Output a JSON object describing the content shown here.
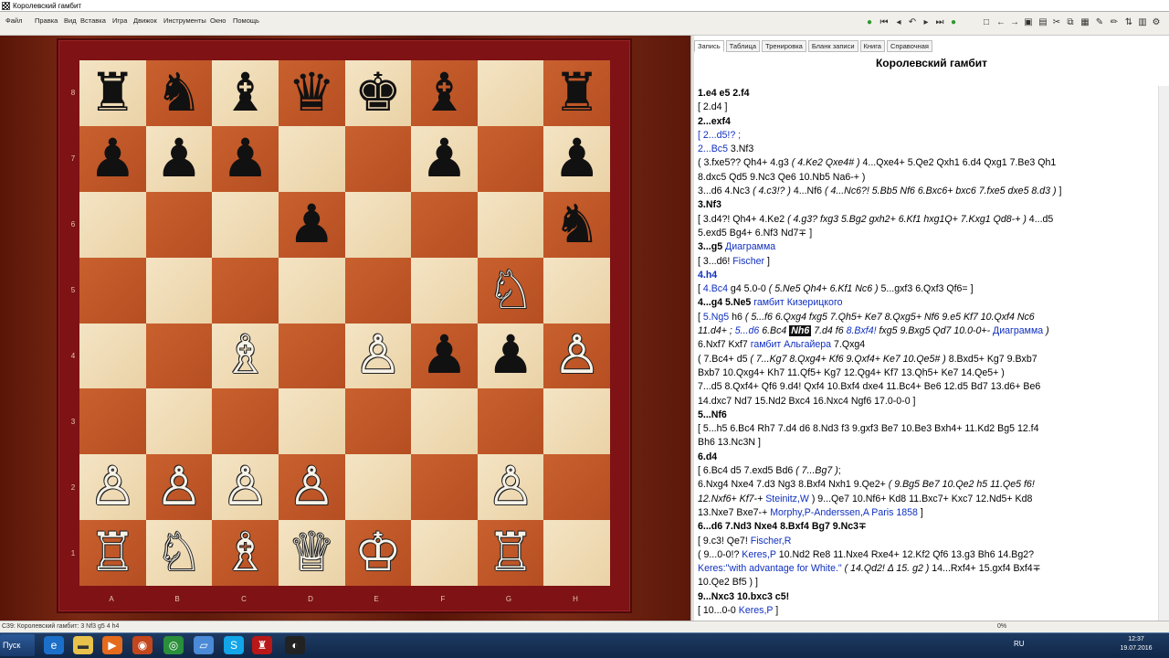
{
  "window": {
    "title": "Королевский гамбит"
  },
  "menu": [
    "Файл",
    "Правка",
    "Вид",
    "Вставка",
    "Игра",
    "Движок",
    "Инструменты",
    "Окно",
    "Помощь"
  ],
  "tabs": [
    "Запись",
    "Таблица",
    "Тренировка",
    "Бланк записи",
    "Книга",
    "Справочная"
  ],
  "notation_title": "Королевский гамбит",
  "board": {
    "light_color": "#f0dcb6",
    "dark_color": "#c05a2a",
    "ranks": [
      "8",
      "7",
      "6",
      "5",
      "4",
      "3",
      "2",
      "1"
    ],
    "files": [
      "A",
      "B",
      "C",
      "D",
      "E",
      "F",
      "G",
      "H"
    ],
    "squares": [
      [
        "♜",
        "♞",
        "♝",
        "♛",
        "♚",
        "♝",
        "",
        "♜"
      ],
      [
        "♟",
        "♟",
        "♟",
        "",
        "",
        "♟",
        "",
        "♟"
      ],
      [
        "",
        "",
        "",
        "♟",
        "",
        "",
        "",
        "♞"
      ],
      [
        "",
        "",
        "",
        "",
        "",
        "",
        "♘",
        ""
      ],
      [
        "",
        "",
        "♗",
        "",
        "♙",
        "♟",
        "♟",
        "♙"
      ],
      [
        "",
        "",
        "",
        "",
        "",
        "",
        "",
        ""
      ],
      [
        "♙",
        "♙",
        "♙",
        "♙",
        "",
        "",
        "♙",
        ""
      ],
      [
        "♖",
        "♘",
        "♗",
        "♕",
        "♔",
        "",
        "♖",
        ""
      ]
    ]
  },
  "notes": [
    [
      [
        "b",
        "1.e4  e5  2.f4"
      ]
    ],
    [
      [
        "",
        "  [ 2.d4 ]"
      ]
    ],
    [
      [
        "b",
        "2...exf4"
      ]
    ],
    [
      [
        "blue",
        "  [ 2...d5!? ;"
      ]
    ],
    [
      [
        "blue",
        "  2...Bc5"
      ],
      [
        "",
        "  3.Nf3"
      ]
    ],
    [
      [
        "",
        "      ( 3.fxe5??  Qh4+  4.g3  "
      ],
      [
        "it",
        "( 4.Ke2  Qxe4# )"
      ],
      [
        "",
        "  4...Qxe4+  5.Qe2  Qxh1  6.d4  Qxg1  7.Be3  Qh1"
      ]
    ],
    [
      [
        "",
        "      8.dxc5  Qd5  9.Nc3  Qe6  10.Nb5  Na6-+ )"
      ]
    ],
    [
      [
        "",
        "    3...d6  4.Nc3  "
      ],
      [
        "it",
        "( 4.c3!? )"
      ],
      [
        "",
        "  4...Nf6  "
      ],
      [
        "it",
        "( 4...Nc6?!  5.Bb5  Nf6  6.Bxc6+  bxc6  7.fxe5  dxe5  8.d3 )"
      ],
      [
        "",
        "  ]"
      ]
    ],
    [
      [
        "b",
        "3.Nf3"
      ]
    ],
    [
      [
        "",
        "  [ 3.d4?!  Qh4+  4.Ke2  "
      ],
      [
        "it",
        "( 4.g3?  fxg3  5.Bg2  gxh2+  6.Kf1  hxg1Q+  7.Kxg1  Qd8-+ )"
      ],
      [
        "",
        "  4...d5"
      ]
    ],
    [
      [
        "",
        "  5.exd5  Bg4+  6.Nf3  Nd7∓ ]"
      ]
    ],
    [
      [
        "b",
        "3...g5"
      ],
      [
        "blue",
        " Диаграмма"
      ]
    ],
    [
      [
        "",
        "  [ 3...d6! "
      ],
      [
        "blue",
        "Fischer"
      ],
      [
        "",
        " ]"
      ]
    ],
    [
      [
        "b blue",
        "4.h4"
      ]
    ],
    [
      [
        "",
        "  [ "
      ],
      [
        "blue",
        "4.Bc4"
      ],
      [
        "",
        "  g4  5.0-0  "
      ],
      [
        "it",
        "( 5.Ne5  Qh4+  6.Kf1  Nc6 )"
      ],
      [
        "",
        "  5...gxf3  6.Qxf3  Qf6= ]"
      ]
    ],
    [
      [
        "b",
        "4...g4  5.Ne5"
      ],
      [
        "blue",
        " гамбит Кизерицкого"
      ]
    ],
    [
      [
        "",
        "  [ "
      ],
      [
        "blue",
        "5.Ng5"
      ],
      [
        "",
        "  h6  "
      ],
      [
        "it",
        "( 5...f6  6.Qxg4  fxg5  7.Qh5+  Ke7  8.Qxg5+  Nf6  9.e5  Kf7  10.Qxf4  Nc6"
      ]
    ],
    [
      [
        "it",
        "  11.d4+ ; "
      ],
      [
        "blue it",
        "5...d6"
      ],
      [
        "it",
        "  6.Bc4 "
      ],
      [
        "hl",
        "Nh6"
      ],
      [
        "it",
        " 7.d4  f6  "
      ],
      [
        "blue it",
        "8.Bxf4!"
      ],
      [
        "it",
        "  fxg5  9.Bxg5  Qd7  10.0-0+- "
      ],
      [
        "blue",
        "Диаграмма"
      ],
      [
        "it",
        "  )"
      ]
    ],
    [
      [
        "",
        "    6.Nxf7  Kxf7 "
      ],
      [
        "blue",
        "гамбит Альгайера"
      ],
      [
        "",
        "  7.Qxg4"
      ]
    ],
    [
      [
        "",
        "      ( 7.Bc4+  d5  "
      ],
      [
        "it",
        "( 7...Kg7  8.Qxg4+  Kf6  9.Qxf4+  Ke7  10.Qe5# )"
      ],
      [
        "",
        "  8.Bxd5+  Kg7  9.Bxb7"
      ]
    ],
    [
      [
        "",
        "      Bxb7  10.Qxg4+  Kh7  11.Qf5+  Kg7  12.Qg4+  Kf7  13.Qh5+  Ke7  14.Qe5+ )"
      ]
    ],
    [
      [
        "",
        "    7...d5  8.Qxf4+  Qf6  9.d4!  Qxf4  10.Bxf4  dxe4  11.Bc4+  Be6  12.d5  Bd7  13.d6+  Be6"
      ]
    ],
    [
      [
        "",
        "    14.dxc7  Nd7  15.Nd2  Bxc4  16.Nxc4  Ngf6  17.0-0-0 ]"
      ]
    ],
    [
      [
        "b",
        "5...Nf6"
      ]
    ],
    [
      [
        "",
        "  [ 5...h5  6.Bc4  Rh7  7.d4  d6  8.Nd3  f3  9.gxf3  Be7  10.Be3  Bxh4+  11.Kd2  Bg5  12.f4"
      ]
    ],
    [
      [
        "",
        "  Bh6  13.Nc3N ]"
      ]
    ],
    [
      [
        "b",
        "6.d4"
      ]
    ],
    [
      [
        "",
        "  [ 6.Bc4  d5  7.exd5  Bd6  "
      ],
      [
        "it",
        "( 7...Bg7 )"
      ],
      [
        "",
        ";"
      ]
    ],
    [
      [
        "",
        "  6.Nxg4  Nxe4  7.d3  Ng3  8.Bxf4  Nxh1  9.Qe2+  "
      ],
      [
        "it",
        "( 9.Bg5  Be7  10.Qe2  h5  11.Qe5  f6!"
      ]
    ],
    [
      [
        "it",
        "  12.Nxf6+  Kf7-+ "
      ],
      [
        "blue",
        "Steinitz,W"
      ],
      [
        "",
        " )  9...Qe7  10.Nf6+  Kd8  11.Bxc7+  Kxc7  12.Nd5+  Kd8"
      ]
    ],
    [
      [
        "",
        "  13.Nxe7  Bxe7-+ "
      ],
      [
        "blue",
        "Morphy,P-Anderssen,A  Paris 1858"
      ],
      [
        "",
        " ]"
      ]
    ],
    [
      [
        "b",
        "6...d6  7.Nd3  Nxe4  8.Bxf4  Bg7  9.Nc3∓"
      ]
    ],
    [
      [
        "",
        "  [ 9.c3!  Qe7! "
      ],
      [
        "blue",
        "Fischer,R"
      ]
    ],
    [
      [
        "",
        "    ( 9...0-0!? "
      ],
      [
        "blue",
        "Keres,P"
      ],
      [
        "",
        "  10.Nd2  Re8  11.Nxe4  Rxe4+  12.Kf2  Qf6  13.g3  Bh6  14.Bg2?"
      ]
    ],
    [
      [
        "blue",
        "    Keres:\"with advantage for White.\""
      ],
      [
        "it",
        "  ( 14.Qd2!  Δ 15. g2 )"
      ],
      [
        "",
        "  14...Rxf4+  15.gxf4  Bxf4∓"
      ]
    ],
    [
      [
        "",
        "    10.Qe2  Bf5 ) ]"
      ]
    ],
    [
      [
        "b",
        "9...Nxc3  10.bxc3  c5!"
      ]
    ],
    [
      [
        "",
        "  [ 10...0-0 "
      ],
      [
        "blue",
        "Keres,P"
      ],
      [
        "",
        " ]"
      ]
    ]
  ],
  "status": {
    "left": "C39: Королевский гамбит: 3 Nf3 g5 4 h4",
    "progress": "0%"
  },
  "taskbar": {
    "start": "Пуск",
    "lang": "RU",
    "time": "12:37",
    "date": "19.07.2016"
  }
}
